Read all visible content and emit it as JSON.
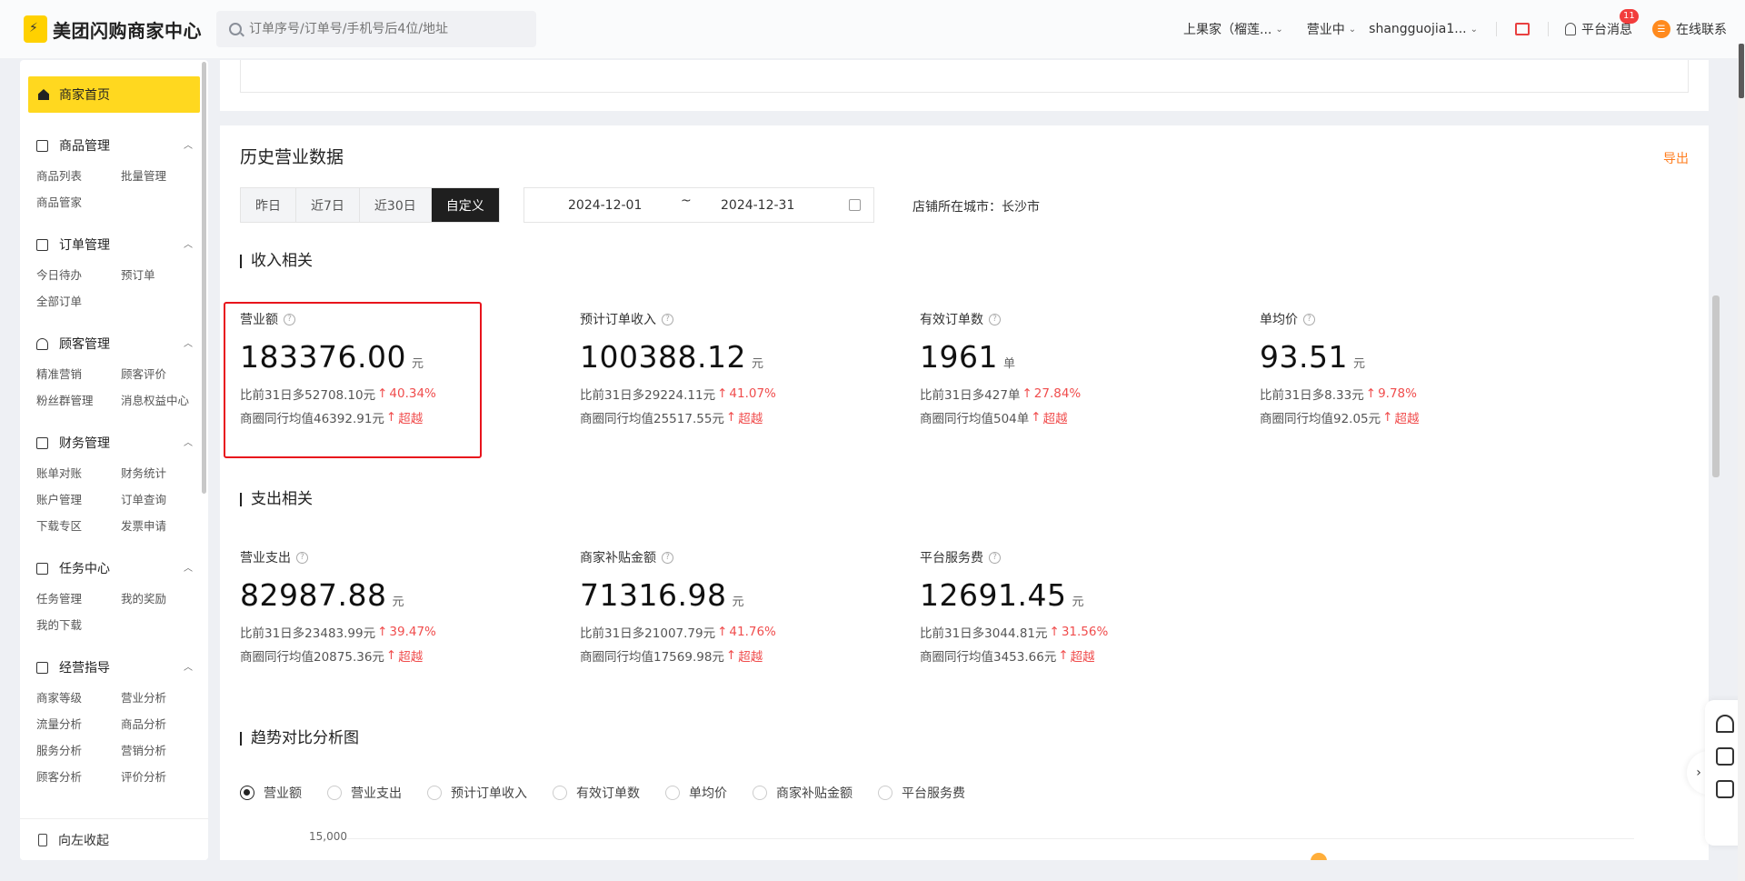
{
  "header": {
    "logo": "美团闪购商家中心",
    "search_placeholder": "订单序号/订单号/手机号后4位/地址",
    "store": "上果家（榴莲...",
    "status": "营业中",
    "account": "shangguojia1...",
    "messages": "平台消息",
    "message_count": "11",
    "service": "在线联系"
  },
  "sidebar": {
    "home": "商家首页",
    "groups": [
      {
        "title": "商品管理",
        "items": [
          "商品列表",
          "批量管理",
          "商品管家"
        ]
      },
      {
        "title": "订单管理",
        "items": [
          "今日待办",
          "预订单",
          "全部订单"
        ]
      },
      {
        "title": "顾客管理",
        "items": [
          "精准营销",
          "顾客评价",
          "粉丝群管理",
          "消息权益中心"
        ]
      },
      {
        "title": "财务管理",
        "items": [
          "账单对账",
          "财务统计",
          "账户管理",
          "订单查询",
          "下载专区",
          "发票申请"
        ]
      },
      {
        "title": "任务中心",
        "items": [
          "任务管理",
          "我的奖励",
          "我的下载"
        ]
      },
      {
        "title": "经营指导",
        "items": [
          "商家等级",
          "营业分析",
          "流量分析",
          "商品分析",
          "服务分析",
          "营销分析",
          "顾客分析",
          "评价分析"
        ]
      }
    ],
    "collapse": "向左收起"
  },
  "history": {
    "title": "历史营业数据",
    "export": "导出",
    "tabs": [
      "昨日",
      "近7日",
      "近30日",
      "自定义"
    ],
    "active_tab": "自定义",
    "date_start": "2024-12-01",
    "date_sep": "~",
    "date_end": "2024-12-31",
    "city": "店铺所在城市：长沙市"
  },
  "income": {
    "title": "收入相关",
    "metrics": [
      {
        "label": "营业额",
        "value": "183376.00",
        "unit": "元",
        "compare": "比前31日多52708.10元",
        "compare_pct": "40.34%",
        "peer": "商圈同行均值46392.91元",
        "peer_status": "超越"
      },
      {
        "label": "预计订单收入",
        "value": "100388.12",
        "unit": "元",
        "compare": "比前31日多29224.11元",
        "compare_pct": "41.07%",
        "peer": "商圈同行均值25517.55元",
        "peer_status": "超越"
      },
      {
        "label": "有效订单数",
        "value": "1961",
        "unit": "单",
        "compare": "比前31日多427单",
        "compare_pct": "27.84%",
        "peer": "商圈同行均值504单",
        "peer_status": "超越"
      },
      {
        "label": "单均价",
        "value": "93.51",
        "unit": "元",
        "compare": "比前31日多8.33元",
        "compare_pct": "9.78%",
        "peer": "商圈同行均值92.05元",
        "peer_status": "超越"
      }
    ]
  },
  "expense": {
    "title": "支出相关",
    "metrics": [
      {
        "label": "营业支出",
        "value": "82987.88",
        "unit": "元",
        "compare": "比前31日多23483.99元",
        "compare_pct": "39.47%",
        "peer": "商圈同行均值20875.36元",
        "peer_status": "超越"
      },
      {
        "label": "商家补贴金额",
        "value": "71316.98",
        "unit": "元",
        "compare": "比前31日多21007.79元",
        "compare_pct": "41.76%",
        "peer": "商圈同行均值17569.98元",
        "peer_status": "超越"
      },
      {
        "label": "平台服务费",
        "value": "12691.45",
        "unit": "元",
        "compare": "比前31日多3044.81元",
        "compare_pct": "31.56%",
        "peer": "商圈同行均值3453.66元",
        "peer_status": "超越"
      }
    ]
  },
  "trend": {
    "title": "趋势对比分析图",
    "options": [
      "营业额",
      "营业支出",
      "预计订单收入",
      "有效订单数",
      "单均价",
      "商家补贴金额",
      "平台服务费"
    ],
    "selected": "营业额",
    "y_tick": "15,000"
  },
  "colors": {
    "accent": "#ffd81f",
    "up": "#f04d4d",
    "export": "#ff7d1e",
    "highlight": "#e8141c"
  }
}
